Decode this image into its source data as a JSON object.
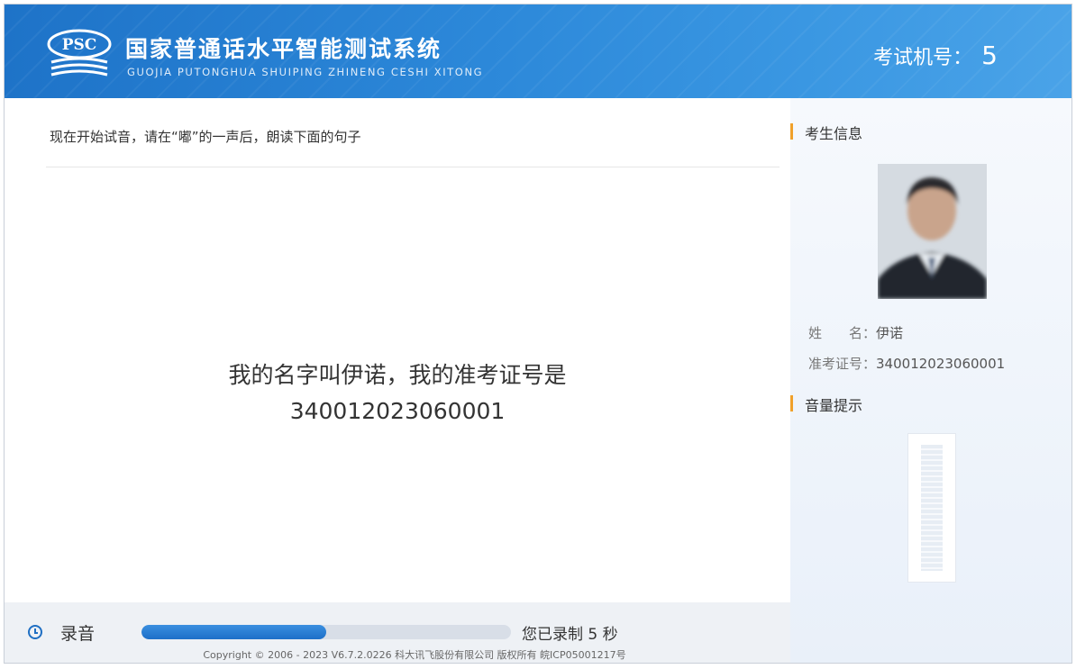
{
  "header": {
    "logo_text": "PSC",
    "title_cn": "国家普通话水平智能测试系统",
    "title_en": "GUOJIA PUTONGHUA SHUIPING ZHINENG CESHI XITONG",
    "exam_machine_label": "考试机号：",
    "exam_machine_number": "5"
  },
  "main": {
    "instruction": "现在开始试音，请在“嘟”的一声后，朗读下面的句子",
    "reading_line1": "我的名字叫伊诺，我的准考证号是",
    "reading_line2": "340012023060001"
  },
  "sidebar": {
    "candidate_section_title": "考生信息",
    "name_label": "姓　　名：",
    "name_value": "伊诺",
    "id_label": "准考证号：",
    "id_value": "340012023060001",
    "volume_section_title": "音量提示",
    "accent_color": "#f0a12b"
  },
  "bottom": {
    "record_label": "录音",
    "record_status": "您已录制 5 秒",
    "progress_fraction": 0.5,
    "copyright": "Copyright © 2006 - 2023 V6.7.2.0226 科大讯飞股份有限公司 版权所有 皖ICP05001217号"
  },
  "colors": {
    "header_blue": "#2a84d6",
    "progress_blue": "#1d6fc8"
  }
}
